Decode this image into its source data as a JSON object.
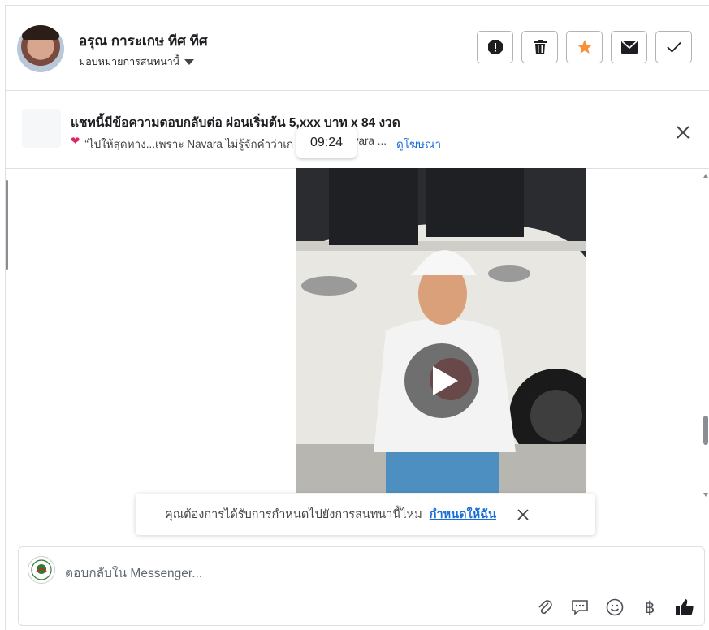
{
  "header": {
    "contact_name": "อรุณ การะเกษ ทีศ ทีศ",
    "assign_label": "มอบหมายการสนทนานี้",
    "actions": [
      "report-icon",
      "trash-icon",
      "star-icon",
      "mail-icon",
      "check-icon"
    ],
    "star_color": "#f7923a"
  },
  "ad": {
    "title": "แชทนี้มีข้อความตอบกลับต่อ ผ่อนเริ่มต้น 5,xxx บาท x 84 งวด",
    "snippet_left": "“ไปให้สุดทาง...เพราะ Navara ไม่รู้จักคำว่าเก",
    "snippet_right": "500 Navara ...",
    "link": "ดูโฆษณา"
  },
  "message": {
    "time": "09:24"
  },
  "toast": {
    "text": "คุณต้องการได้รับการกำหนดไปยังการสนทนานี้ไหม",
    "link": "กำหนดให้ฉัน"
  },
  "composer": {
    "placeholder": "ตอบกลับใน Messenger...",
    "tools": [
      "attach-icon",
      "saved-reply-icon",
      "emoji-icon",
      "baht-icon",
      "like-icon"
    ],
    "baht_symbol": "฿"
  }
}
